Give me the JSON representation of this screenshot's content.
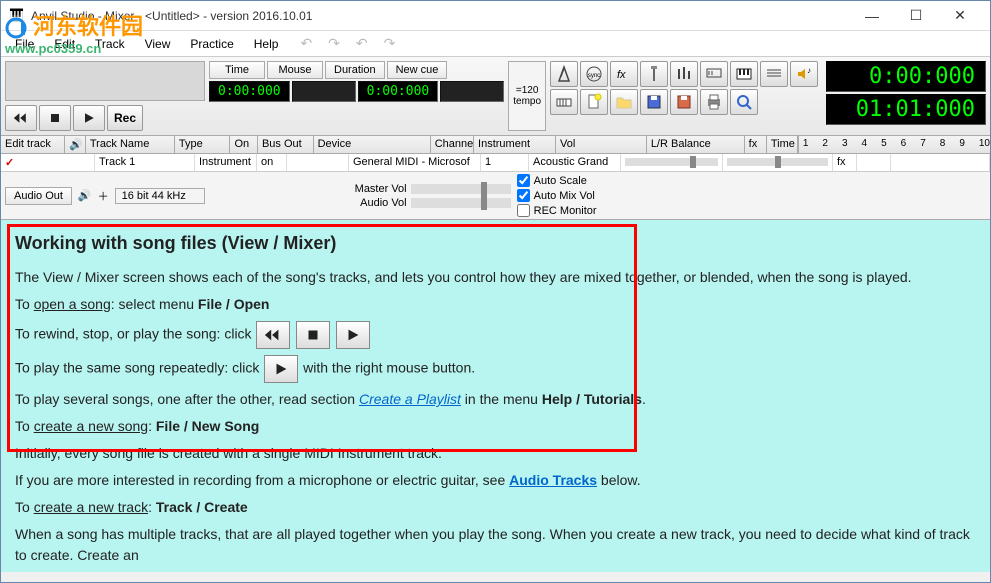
{
  "window": {
    "title": "Anvil Studio - Mixer - <Untitled> - version 2016.10.01",
    "min": "—",
    "max": "☐",
    "close": "✕"
  },
  "menu": [
    "File",
    "Edit",
    "Track",
    "View",
    "Practice",
    "Help"
  ],
  "watermark": {
    "text1": "河东软件园",
    "text2": "www.pc0359.cn"
  },
  "toolbar": {
    "time_btn": "Time",
    "mouse_btn": "Mouse",
    "duration_btn": "Duration",
    "newcue_btn": "New cue",
    "readout_time": "0:00:000",
    "readout_dur": "0:00:000",
    "tempo_val": "=120",
    "tempo_lbl": "tempo",
    "rec": "Rec",
    "big_time": "0:00:000",
    "big_pos": "01:01:000"
  },
  "track_columns": {
    "edit": "Edit track",
    "name": "Track Name",
    "type": "Type",
    "on": "On",
    "bus": "Bus Out",
    "device": "Device",
    "chan": "Channel",
    "inst": "Instrument",
    "vol": "Vol",
    "bal": "L/R Balance",
    "fx": "fx",
    "time": "Time"
  },
  "ruler": [
    "1",
    "2",
    "3",
    "4",
    "5",
    "6",
    "7",
    "8",
    "9",
    "10"
  ],
  "track1": {
    "name": "Track 1",
    "type": "Instrument",
    "on": "on",
    "bus": "",
    "device": "General MIDI - Microsof",
    "chan": "1",
    "inst": "Acoustic Grand",
    "fx": "fx"
  },
  "mix": {
    "audio_out": "Audio Out",
    "format": "16 bit 44 kHz",
    "master": "Master Vol",
    "audio": "Audio Vol",
    "autoscale": "Auto Scale",
    "automix": "Auto Mix Vol",
    "recmon": "REC Monitor"
  },
  "help": {
    "h": "Working with song files (View / Mixer)",
    "p1": "The View / Mixer screen shows each of the song's tracks, and lets you control how they are mixed together, or blended, when the song is played.",
    "p2a": "To ",
    "p2u": "open a song",
    "p2b": ": select menu ",
    "p2bold": "File / Open",
    "p3": "To rewind, stop, or play the song: click ",
    "p4a": "To play the same song repeatedly: click ",
    "p4b": " with the right mouse button.",
    "p5a": "To play several songs, one after the other, read section ",
    "p5link": "Create a Playlist",
    "p5b": " in the menu ",
    "p5bold": "Help / Tutorials",
    "p5c": ".",
    "p6a": "To ",
    "p6u": "create a new song",
    "p6b": ": ",
    "p6bold": "File / New Song",
    "p7": "Initially, every song file is created with a single MIDI Instrument track.",
    "p8a": "If you are more interested in recording from a microphone or electric guitar, see ",
    "p8link": "Audio Tracks",
    "p8b": " below.",
    "p9a": "To ",
    "p9u": "create a new track",
    "p9b": ": ",
    "p9bold": "Track / Create",
    "p10": "When a song has multiple tracks, that are all played together when you play the song. When you create a new track, you need to decide what kind of track to create. Create an"
  }
}
